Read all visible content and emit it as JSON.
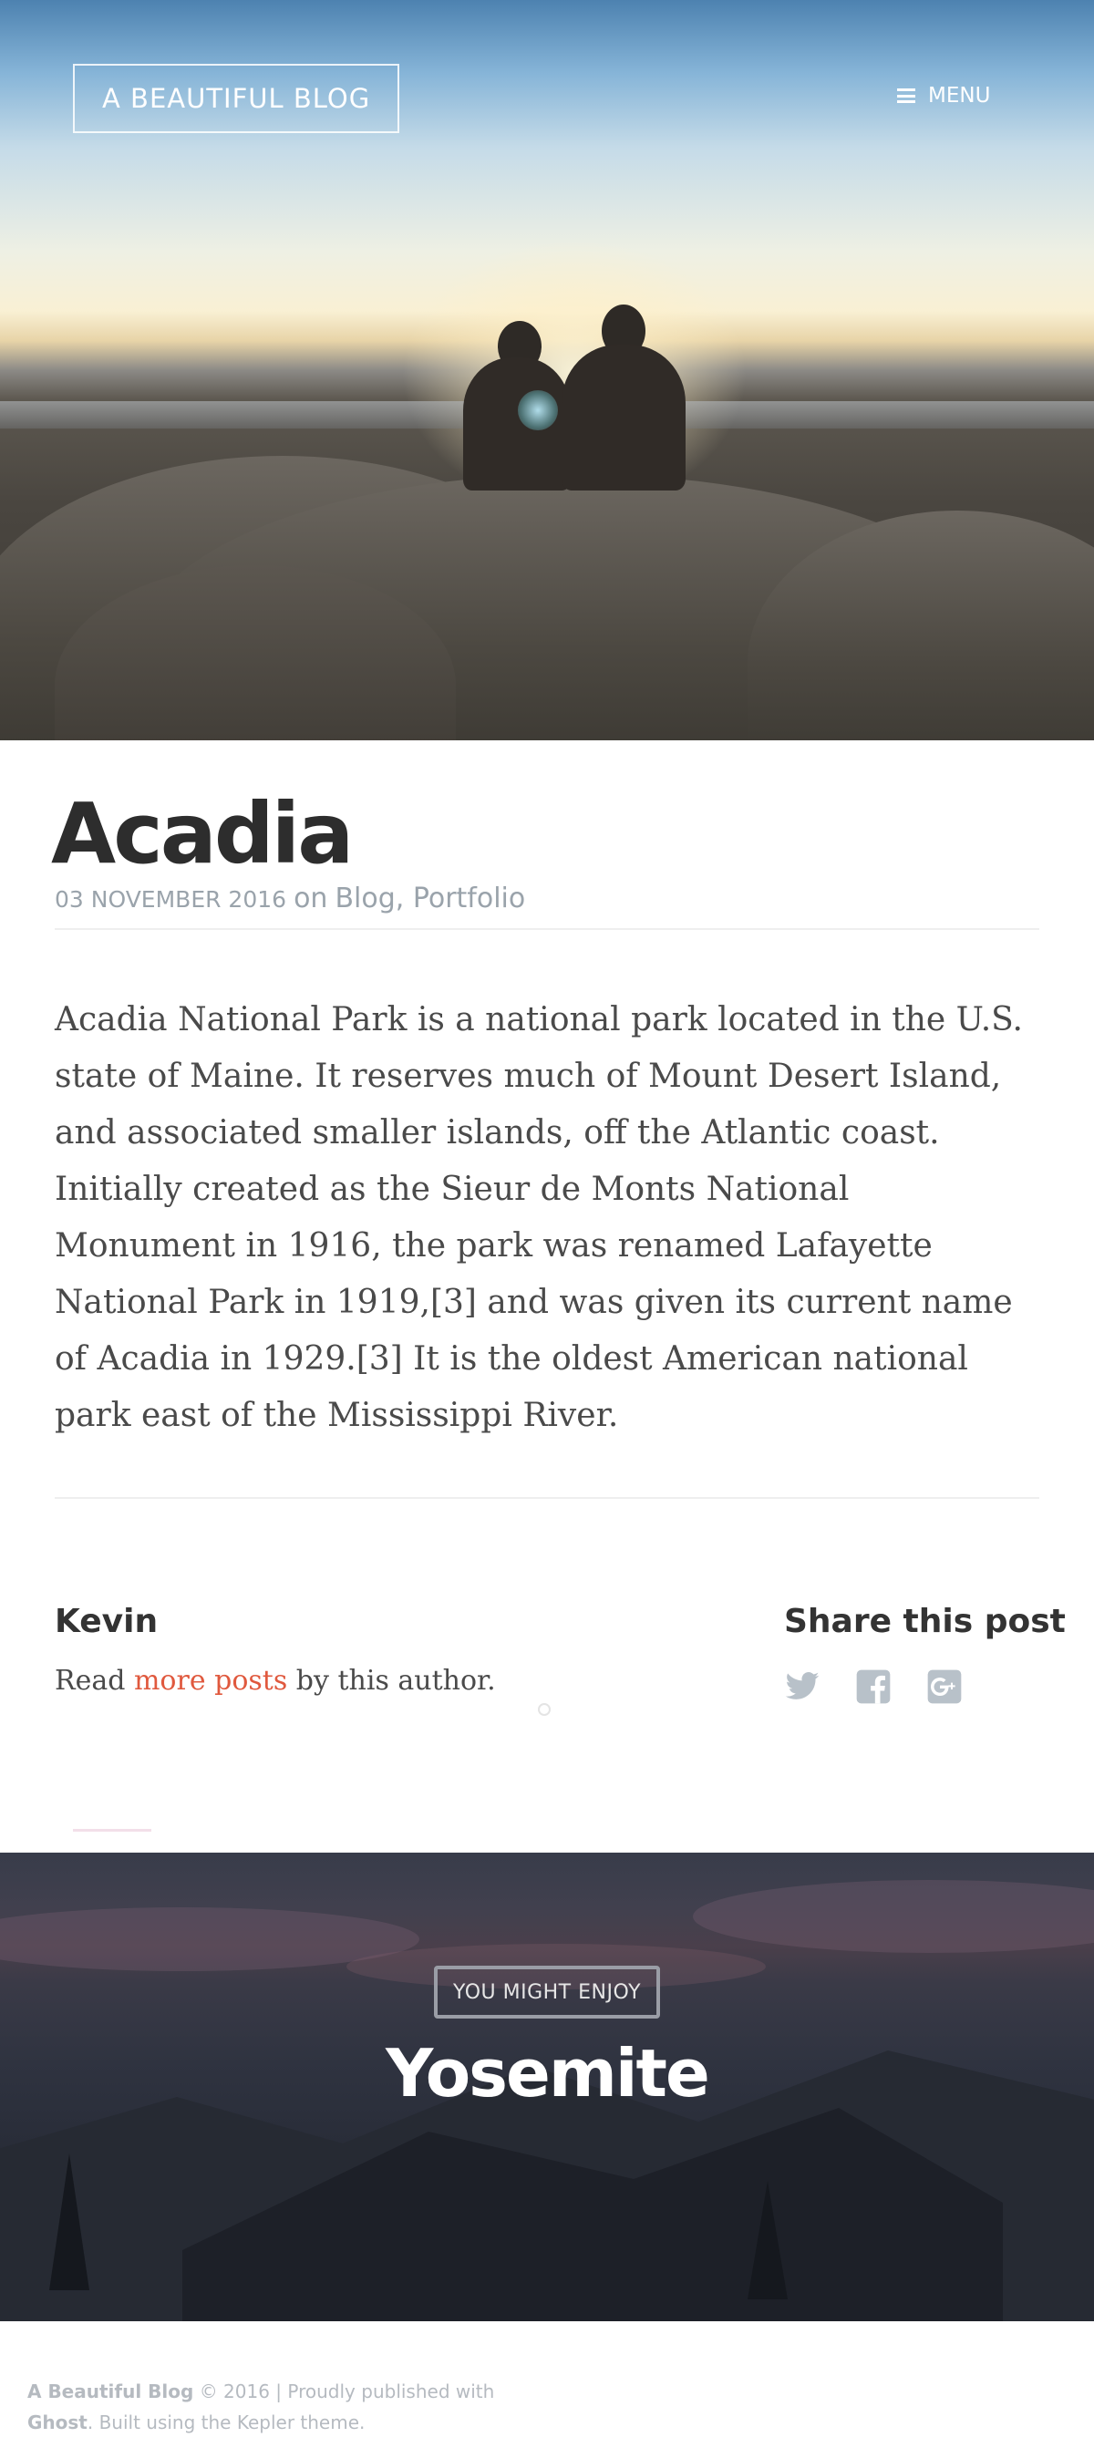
{
  "header": {
    "brand": "A BEAUTIFUL BLOG",
    "menu_label": "MENU",
    "menu_icon": "hamburger-icon"
  },
  "post": {
    "title": "Acadia",
    "date": "03 NOVEMBER 2016",
    "on_word": "on",
    "tags": "Blog, Portfolio",
    "body": "Acadia National Park is a national park located in the U.S. state of Maine. It reserves much of Mount Desert Island, and associated smaller islands, off the Atlantic coast. Initially created as the Sieur de Monts National Monument in 1916, the park was renamed Lafayette National Park in 1919,[3] and was given its current name of Acadia in 1929.[3] It is the oldest American national park east of the Mississippi River."
  },
  "author": {
    "name": "Kevin",
    "read_prefix": "Read",
    "more_posts_link": "more posts",
    "read_suffix": "by this author."
  },
  "share": {
    "title": "Share this post",
    "icons": [
      "twitter-icon",
      "facebook-icon",
      "google-plus-icon"
    ],
    "icon_color": "#b8c1c9"
  },
  "read_next": {
    "label": "YOU MIGHT ENJOY",
    "title": "Yosemite"
  },
  "footer": {
    "site_name": "A Beautiful Blog",
    "copyright": "© 2016 | Proudly published with",
    "platform": "Ghost",
    "theme_note": ". Built using the Kepler theme."
  },
  "colors": {
    "link": "#e0593e",
    "title": "#2d2d2d",
    "meta": "#9aa3ab"
  }
}
